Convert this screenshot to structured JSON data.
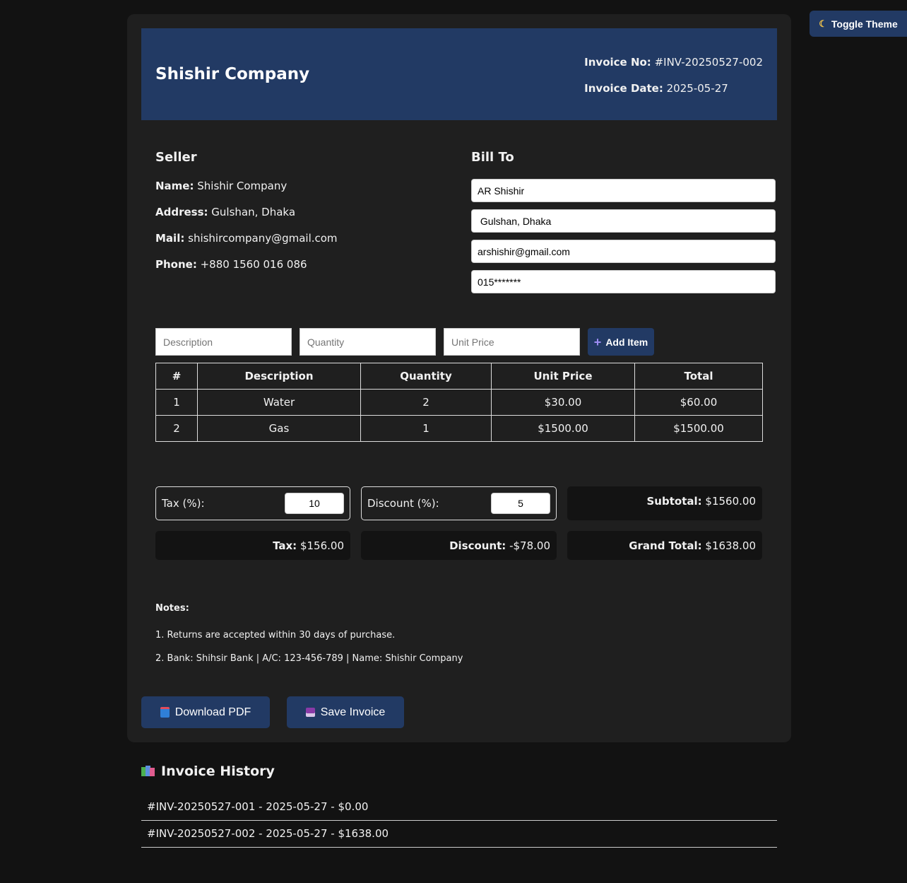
{
  "toolbar": {
    "theme_label": "Toggle Theme",
    "theme_icon": "moon-icon"
  },
  "invoice": {
    "company_name": "Shishir Company",
    "number_label": "Invoice No:",
    "number": "#INV-20250527-002",
    "date_label": "Invoice Date:",
    "date": "2025-05-27"
  },
  "seller": {
    "title": "Seller",
    "name_label": "Name:",
    "name": "Shishir Company",
    "address_label": "Address:",
    "address": "Gulshan, Dhaka",
    "mail_label": "Mail:",
    "mail": "shishircompany@gmail.com",
    "phone_label": "Phone:",
    "phone": "+880 1560 016 086"
  },
  "bill_to": {
    "title": "Bill To",
    "name": "AR Shishir",
    "address": " Gulshan, Dhaka",
    "email": "arshishir@gmail.com",
    "phone": "015*******"
  },
  "add_item": {
    "description_placeholder": "Description",
    "quantity_placeholder": "Quantity",
    "unit_price_placeholder": "Unit Price",
    "button_label": "Add Item",
    "button_icon": "plus-icon"
  },
  "table": {
    "headers": [
      "#",
      "Description",
      "Quantity",
      "Unit Price",
      "Total"
    ],
    "rows": [
      [
        "1",
        "Water",
        "2",
        "$30.00",
        "$60.00"
      ],
      [
        "2",
        "Gas",
        "1",
        "$1500.00",
        "$1500.00"
      ]
    ]
  },
  "summary": {
    "tax_input_label": "Tax (%):",
    "tax_percent": "10",
    "discount_input_label": "Discount (%):",
    "discount_percent": "5",
    "subtotal_label": "Subtotal:",
    "subtotal": "$1560.00",
    "tax_label": "Tax:",
    "tax": "$156.00",
    "discount_label": "Discount:",
    "discount": "-$78.00",
    "grand_total_label": "Grand Total:",
    "grand_total": "$1638.00"
  },
  "notes": {
    "title": "Notes:",
    "lines": [
      "1. Returns are accepted within 30 days of purchase.",
      "2. Bank: Shihsir Bank | A/C: 123-456-789 | Name: Shishir Company"
    ]
  },
  "actions": {
    "download_label": "Download PDF",
    "download_icon": "inbox-tray-icon",
    "save_label": "Save Invoice",
    "save_icon": "floppy-disk-icon"
  },
  "history": {
    "title": "Invoice History",
    "icon": "books-icon",
    "items": [
      "#INV-20250527-001 - 2025-05-27 - $0.00",
      "#INV-20250527-002 - 2025-05-27 - $1638.00"
    ]
  },
  "colors": {
    "background": "#121212",
    "card": "#1f1f1f",
    "accent": "#223a64",
    "summary_box": "#131313"
  }
}
